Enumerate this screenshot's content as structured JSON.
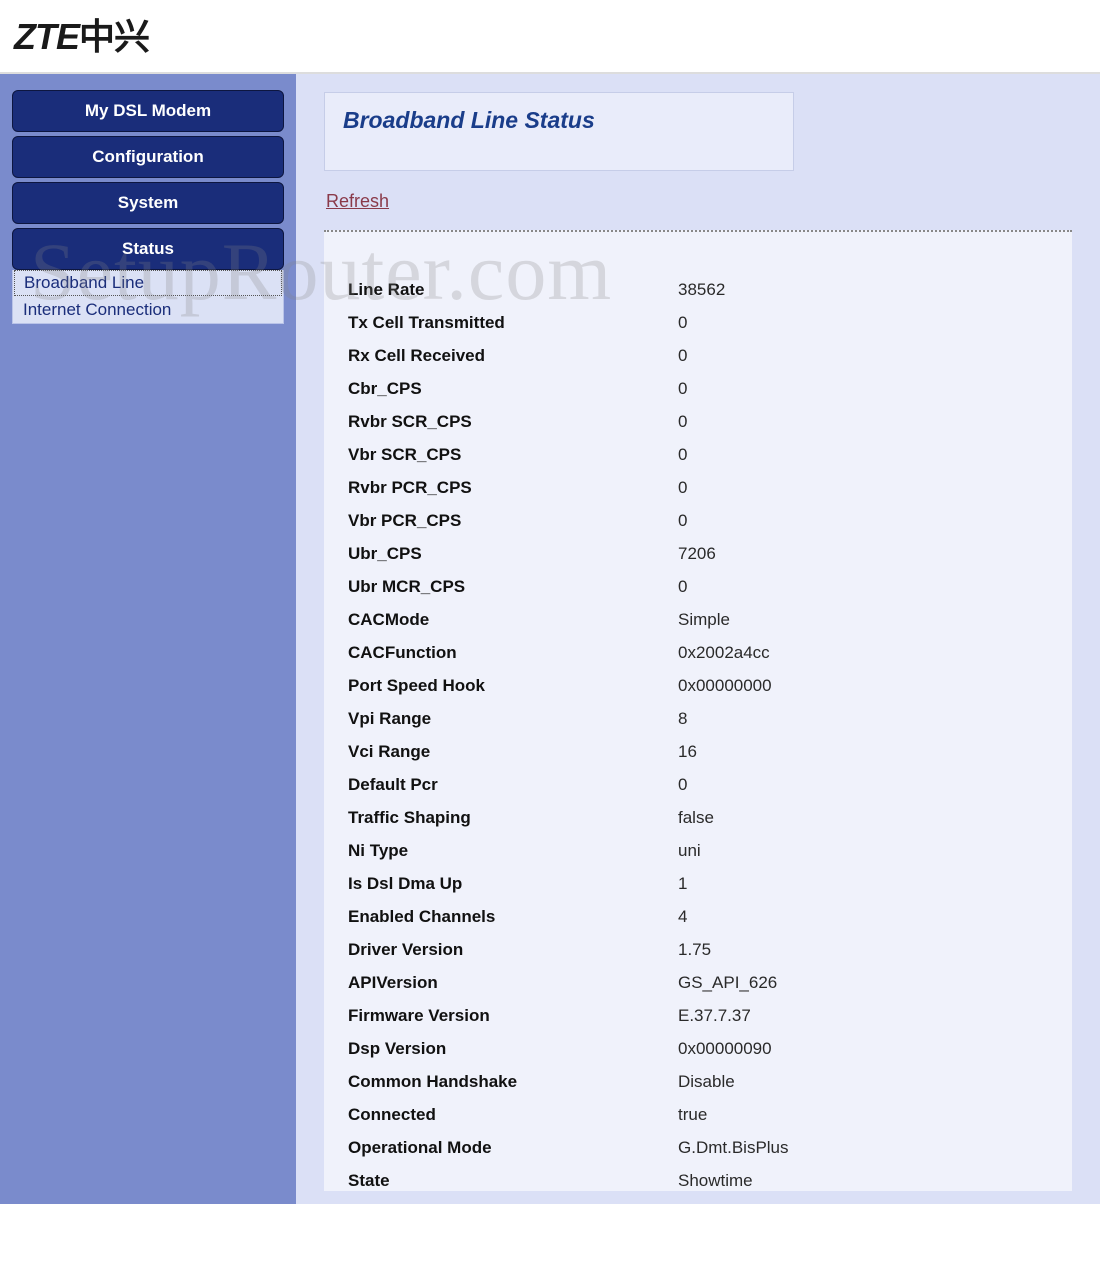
{
  "logo": {
    "en": "ZTE",
    "cn": "中兴"
  },
  "nav": [
    {
      "label": "My DSL Modem"
    },
    {
      "label": "Configuration"
    },
    {
      "label": "System"
    },
    {
      "label": "Status"
    }
  ],
  "subnav": [
    {
      "label": "Broadband Line",
      "selected": true
    },
    {
      "label": "Internet Connection",
      "selected": false
    }
  ],
  "page_title": "Broadband Line Status",
  "refresh_label": "Refresh",
  "watermark": "SetupRouter.com",
  "stats": [
    {
      "label": "Line Rate",
      "value": "38562"
    },
    {
      "label": "Tx Cell Transmitted",
      "value": "0"
    },
    {
      "label": "Rx Cell Received",
      "value": "0"
    },
    {
      "label": "Cbr_CPS",
      "value": "0"
    },
    {
      "label": "Rvbr SCR_CPS",
      "value": "0"
    },
    {
      "label": "Vbr SCR_CPS",
      "value": "0"
    },
    {
      "label": "Rvbr PCR_CPS",
      "value": "0"
    },
    {
      "label": "Vbr PCR_CPS",
      "value": "0"
    },
    {
      "label": "Ubr_CPS",
      "value": "7206"
    },
    {
      "label": "Ubr MCR_CPS",
      "value": "0"
    },
    {
      "label": "CACMode",
      "value": "Simple"
    },
    {
      "label": "CACFunction",
      "value": "0x2002a4cc"
    },
    {
      "label": "Port Speed Hook",
      "value": "0x00000000"
    },
    {
      "label": "Vpi Range",
      "value": "8"
    },
    {
      "label": "Vci Range",
      "value": "16"
    },
    {
      "label": "Default Pcr",
      "value": "0"
    },
    {
      "label": "Traffic Shaping",
      "value": "false"
    },
    {
      "label": "Ni Type",
      "value": "uni"
    },
    {
      "label": "Is Dsl Dma Up",
      "value": "1"
    },
    {
      "label": "Enabled Channels",
      "value": "4"
    },
    {
      "label": "Driver Version",
      "value": "1.75"
    },
    {
      "label": "APIVersion",
      "value": "GS_API_626"
    },
    {
      "label": "Firmware Version",
      "value": "E.37.7.37"
    },
    {
      "label": "Dsp Version",
      "value": "0x00000090"
    },
    {
      "label": "Common Handshake",
      "value": "Disable"
    },
    {
      "label": "Connected",
      "value": "true"
    },
    {
      "label": "Operational Mode",
      "value": "G.Dmt.BisPlus"
    },
    {
      "label": "State",
      "value": "Showtime"
    }
  ]
}
